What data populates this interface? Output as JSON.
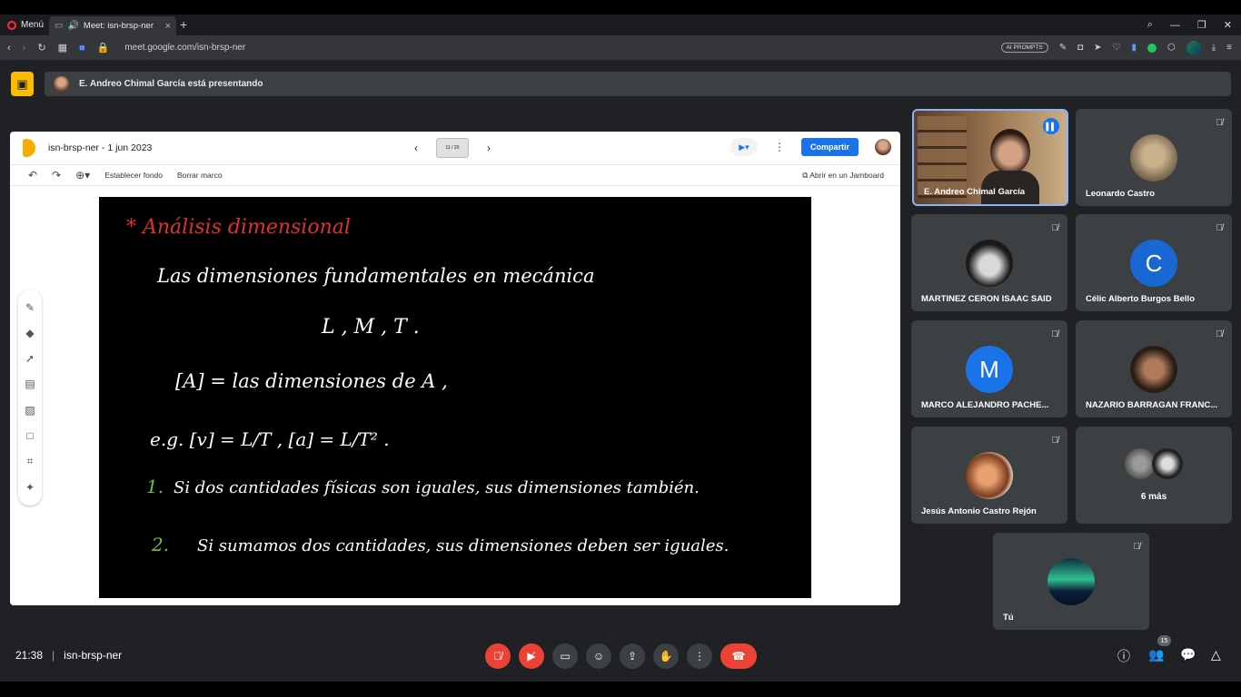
{
  "browser": {
    "menu_label": "Menú",
    "tab_title": "Meet: isn-brsp-ner",
    "url": "meet.google.com/isn-brsp-ner",
    "ai_prompts": "AI PROMPTS"
  },
  "banner": {
    "text": "E. Andreo Chimal García está presentando"
  },
  "jamboard": {
    "title": "isn-brsp-ner - 1 jun 2023",
    "frame_counter": "11 / 20",
    "share_label": "Compartir",
    "set_background": "Establecer fondo",
    "clear_frame": "Borrar marco",
    "open_jamboard": "Abrir en un Jamboard"
  },
  "board_text": {
    "heading": "* Análisis dimensional",
    "line1": "Las dimensiones fundamentales en mecánica",
    "line2": "L , M , T .",
    "line3": "[A] = las dimensiones de A ,",
    "line4": "e.g. [v] = L/T , [a] = L/T² .",
    "item1_num": "1.",
    "item1": "Si dos cantidades físicas son iguales, sus dimensiones también.",
    "item2_num": "2.",
    "item2": "Si sumamos dos cantidades, sus dimensiones deben ser iguales."
  },
  "participants": [
    {
      "name": "E. Andreo Chimal García"
    },
    {
      "name": "Leonardo Castro"
    },
    {
      "name": "MARTINEZ CERON ISAAC SAID"
    },
    {
      "name": "Célic Alberto Burgos Bello",
      "initial": "C"
    },
    {
      "name": "MARCO ALEJANDRO PACHE...",
      "initial": "M"
    },
    {
      "name": "NAZARIO BARRAGAN FRANC..."
    },
    {
      "name": "Jesús Antonio Castro Rejón"
    },
    {
      "name": "6 más"
    },
    {
      "name": "Tú"
    }
  ],
  "bottom": {
    "time": "21:38",
    "meeting_code": "isn-brsp-ner",
    "participant_count": "15"
  },
  "colors": {
    "present_icon": "#fbbc04",
    "share_button": "#1a73e8",
    "end_call": "#ea4335",
    "avatar_blue": "#1967d2"
  }
}
